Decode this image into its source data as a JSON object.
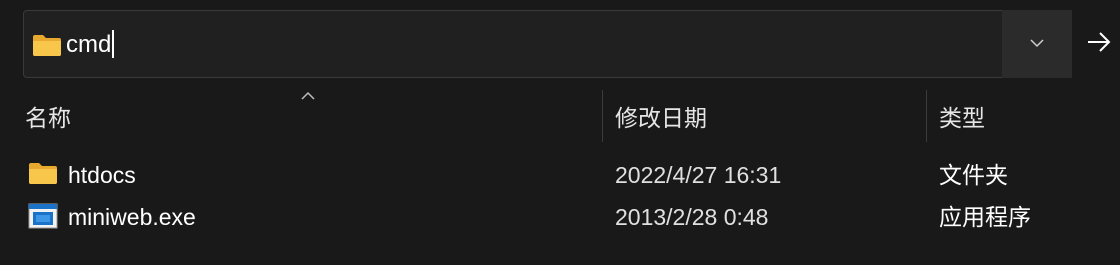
{
  "address_bar": {
    "path": "cmd"
  },
  "columns": {
    "name": "名称",
    "date_modified": "修改日期",
    "type": "类型"
  },
  "files": [
    {
      "name": "htdocs",
      "modified": "2022/4/27 16:31",
      "type": "文件夹",
      "icon": "folder-icon"
    },
    {
      "name": "miniweb.exe",
      "modified": "2013/2/28 0:48",
      "type": "应用程序",
      "icon": "exe-icon"
    }
  ],
  "colors": {
    "background": "#191919",
    "address_bar_bg": "#202020",
    "folder_yellow": "#F7C64A",
    "exe_blue": "#1a73c8"
  }
}
